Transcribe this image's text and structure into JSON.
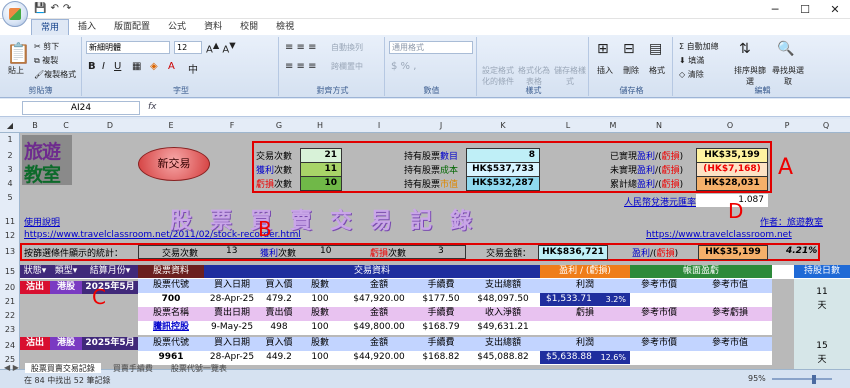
{
  "titlebar": {
    "controls": [
      "─",
      "☐",
      "✕"
    ]
  },
  "ribbon": {
    "tabs": [
      "常用",
      "插入",
      "版面配置",
      "公式",
      "資料",
      "校閱",
      "檢視"
    ],
    "clipboard": {
      "paste": "貼上",
      "cut": "剪下",
      "copy": "複製",
      "format_painter": "複製格式",
      "label": "剪貼簿"
    },
    "font": {
      "name": "新細明體",
      "size": "12",
      "label": "字型"
    },
    "alignment": {
      "wrap": "自動換列",
      "merge": "跨欄置中",
      "label": "對齊方式"
    },
    "number": {
      "format": "通用格式",
      "label": "數值"
    },
    "styles": {
      "conditional": "設定格式化的條件",
      "table": "格式化為表格",
      "cell": "儲存格樣式",
      "label": "樣式"
    },
    "cells": {
      "insert": "插入",
      "delete": "刪除",
      "format": "格式",
      "label": "儲存格"
    },
    "editing": {
      "autosum": "自動加總",
      "fill": "填滿",
      "clear": "清除",
      "sort": "排序與篩選",
      "find": "尋找與選取",
      "label": "編輯"
    }
  },
  "formula": {
    "namebox": "AI24",
    "fx": "fx"
  },
  "columns": [
    "A",
    "B",
    "C",
    "D",
    "E",
    "F",
    "G",
    "H",
    "I",
    "J",
    "K",
    "L",
    "M",
    "N",
    "O",
    "P",
    "Q"
  ],
  "rows": [
    "1",
    "2",
    "3",
    "4",
    "5",
    "",
    "",
    "",
    "11",
    "12",
    "13",
    "",
    "15",
    "20",
    "21",
    "22",
    "23",
    "24",
    "25"
  ],
  "logo": {
    "line1": "旅遊",
    "line2": "教室"
  },
  "new_trade": "新交易",
  "stats": {
    "trades_label": "交易次數",
    "trades": "21",
    "wins_label": "獲利",
    "wins_suffix": "次數",
    "wins": "11",
    "loss_label": "虧損",
    "loss_suffix": "次數",
    "loss": "10",
    "hold_count_label": "持有股票",
    "hold_count_suffix": "數目",
    "hold_count": "8",
    "hold_cost_label": "持有股票",
    "hold_cost_suffix": "成本",
    "hold_cost": "HK$537,733",
    "hold_value_label": "持有股票",
    "hold_value_suffix": "市值",
    "hold_value": "HK$532,287",
    "realized_label": "已實現",
    "realized_a": "盈利",
    "realized_b": "虧損",
    "realized": "HK$35,199",
    "unrealized_label": "未實現",
    "unrealized": "(HK$7,168)",
    "total_label": "累計總",
    "total": "HK$28,031",
    "fx_label": "人民幣兌港元匯率",
    "fx": "1.087"
  },
  "banner": "股票買賣交易記錄",
  "links": {
    "guide": "使用說明",
    "url1": "https://www.travelclassroom.net/2011/02/stock-recorder.html",
    "author": "作者：旅遊教室",
    "url2": "https://www.travelclassroom.net"
  },
  "filterbar": {
    "label": "按篩選條件顯示的統計：",
    "trades_label": "交易次數",
    "trades": "13",
    "wins_label": "獲利",
    "wins_suffix": "次數",
    "wins": "10",
    "loss_label": "虧損",
    "loss_suffix": "次數",
    "loss": "3",
    "amount_label": "交易金額：",
    "amount": "HK$836,721",
    "pl_a": "盈利",
    "pl_b": "虧損",
    "pl": "HK$35,199",
    "pct": "4.21%"
  },
  "markers": {
    "A": "A",
    "B": "B",
    "C": "C",
    "D": "D"
  },
  "table": {
    "filters": [
      "狀態",
      "類型",
      "結算月份"
    ],
    "sections": {
      "stock": "股票資料",
      "trade": "交易資料",
      "pl": "盈利 / (虧損)",
      "paper": "帳面盈虧",
      "hold": "持股日數"
    },
    "buy_headers": [
      "股票代號",
      "買入日期",
      "買入價",
      "股數",
      "金額",
      "手續費",
      "支出總額",
      "利潤",
      "參考市價",
      "參考市值"
    ],
    "sell_headers": [
      "股票名稱",
      "賣出日期",
      "賣出價",
      "股數",
      "金額",
      "手續費",
      "收入淨額",
      "虧損",
      "參考市價",
      "參考虧損"
    ],
    "records": [
      {
        "status": "沽出",
        "type": "港股",
        "month": "2025年5月",
        "code": "700",
        "buy_date": "28-Apr-25",
        "buy_price": "479.2",
        "shares": "100",
        "amount": "$47,920.00",
        "fee": "$177.50",
        "total": "$48,097.50",
        "profit": "$1,533.71",
        "pct": "3.2%",
        "name": "騰訊控股",
        "sell_date": "9-May-25",
        "sell_price": "498",
        "sell_shares": "100",
        "sell_amount": "$49,800.00",
        "sell_fee": "$168.79",
        "net": "$49,631.21",
        "days": "11",
        "days_unit": "天"
      },
      {
        "status": "沽出",
        "type": "港股",
        "month": "2025年5月",
        "code": "9961",
        "buy_date": "28-Apr-25",
        "buy_price": "449.2",
        "shares": "100",
        "amount": "$44,920.00",
        "fee": "$168.82",
        "total": "$45,088.82",
        "profit": "$5,638.88",
        "pct": "12.6%",
        "days": "15",
        "days_unit": "天"
      }
    ]
  },
  "sheet_tabs": [
    "股票買賣交易記錄",
    "買賣手續費",
    "股票代號一覽表"
  ],
  "status": {
    "text": "在 84 中找出 52 筆記錄",
    "zoom": "95%"
  }
}
